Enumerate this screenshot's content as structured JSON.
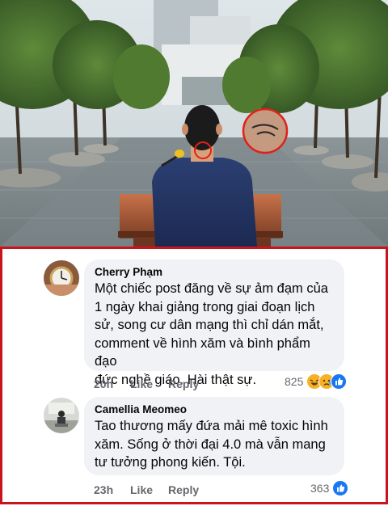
{
  "comments": [
    {
      "author": "Cherry Phạm",
      "text": "Một chiếc post đăng về sự ảm đạm của\n1 ngày khai giảng trong giai đoạn lịch\nsử, song cư dân mạng thì chỉ dán mắt,\ncomment về hình xăm và bình phẩm đạo\nđức nghề giáo. Hài thật sự.",
      "time": "20h",
      "like_label": "Like",
      "reply_label": "Reply",
      "reaction_count": "825",
      "reactions": [
        "haha-icon",
        "sad-icon",
        "like-icon"
      ]
    },
    {
      "author": "Camellia Meomeo",
      "text": "Tao thương mấy đứa mải mê toxic hình\nxăm. Sống ở thời đại 4.0 mà vẫn mang\ntư tưởng phong kiến. Tội.",
      "time": "23h",
      "like_label": "Like",
      "reply_label": "Reply",
      "reaction_count": "363",
      "reactions": [
        "like-icon"
      ]
    }
  ],
  "colors": {
    "highlight_border": "#c8141c",
    "bubble": "#f0f2f5",
    "meta_text": "#65676b",
    "like_blue": "#1877f2"
  }
}
